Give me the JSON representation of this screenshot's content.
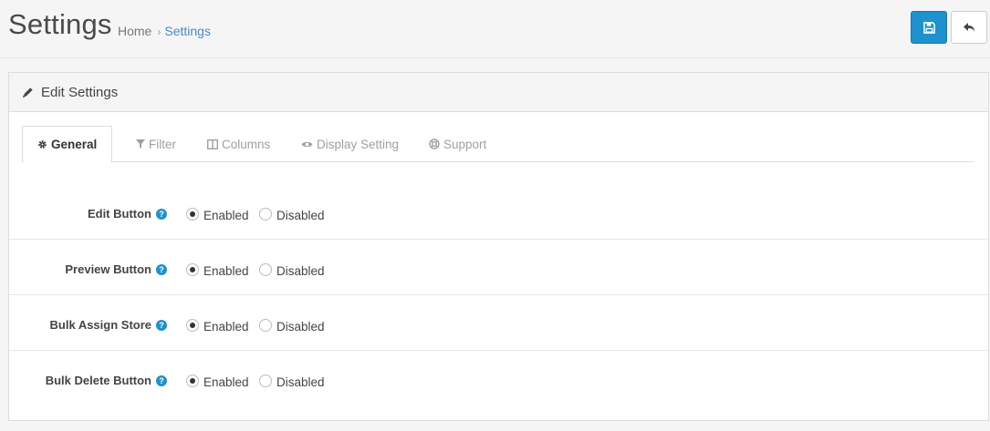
{
  "header": {
    "title": "Settings",
    "breadcrumb": [
      {
        "label": "Home"
      },
      {
        "label": "Settings"
      }
    ],
    "save_icon": "save-icon",
    "back_icon": "reply-icon"
  },
  "panel": {
    "title": "Edit Settings",
    "title_icon": "pencil-icon"
  },
  "tabs": [
    {
      "label": "General",
      "icon": "gear-icon",
      "active": true
    },
    {
      "label": "Filter",
      "icon": "filter-icon",
      "active": false
    },
    {
      "label": "Columns",
      "icon": "columns-icon",
      "active": false
    },
    {
      "label": "Display Setting",
      "icon": "eye-icon",
      "active": false
    },
    {
      "label": "Support",
      "icon": "life-ring-icon",
      "active": false
    }
  ],
  "settings": [
    {
      "label": "Edit Button",
      "enabled_label": "Enabled",
      "disabled_label": "Disabled",
      "value": "Enabled"
    },
    {
      "label": "Preview Button",
      "enabled_label": "Enabled",
      "disabled_label": "Disabled",
      "value": "Enabled"
    },
    {
      "label": "Bulk Assign Store",
      "enabled_label": "Enabled",
      "disabled_label": "Disabled",
      "value": "Enabled"
    },
    {
      "label": "Bulk Delete Button",
      "enabled_label": "Enabled",
      "disabled_label": "Disabled",
      "value": "Enabled"
    }
  ],
  "help_glyph": "?",
  "breadcrumb_separator": "›",
  "colors": {
    "primary": "#1e91cf",
    "link": "#4a8ac4"
  }
}
